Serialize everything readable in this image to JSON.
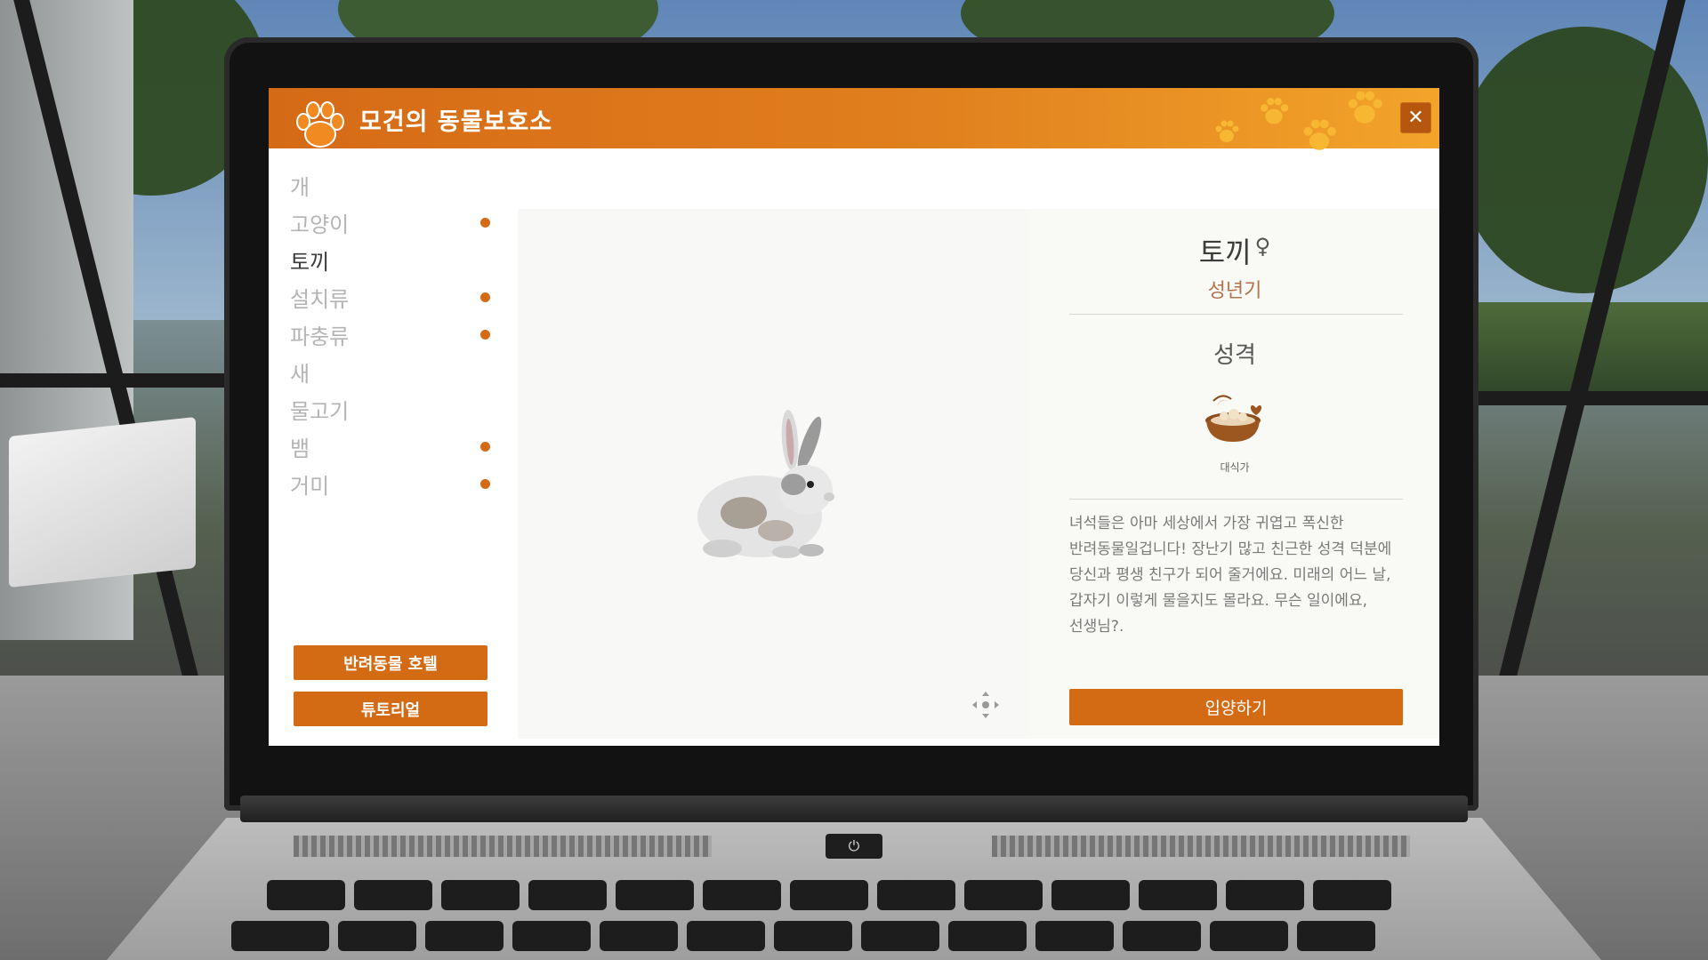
{
  "app": {
    "title": "모건의 동물보호소",
    "close_label": "✕"
  },
  "sidebar": {
    "categories": [
      {
        "label": "개",
        "active": false,
        "has_dot": false
      },
      {
        "label": "고양이",
        "active": false,
        "has_dot": true
      },
      {
        "label": "토끼",
        "active": true,
        "has_dot": false
      },
      {
        "label": "설치류",
        "active": false,
        "has_dot": true
      },
      {
        "label": "파충류",
        "active": false,
        "has_dot": true
      },
      {
        "label": "새",
        "active": false,
        "has_dot": false
      },
      {
        "label": "물고기",
        "active": false,
        "has_dot": false
      },
      {
        "label": "뱀",
        "active": false,
        "has_dot": true
      },
      {
        "label": "거미",
        "active": false,
        "has_dot": true
      }
    ],
    "buttons": {
      "hotel": "반려동물 호텔",
      "tutorial": "튜토리얼"
    }
  },
  "detail": {
    "name": "토끼",
    "gender_symbol": "♀",
    "age": "성년기",
    "section_title": "성격",
    "trait": {
      "icon": "food-bowl-icon",
      "label": "대식가"
    },
    "description": "녀석들은 아마 세상에서 가장 귀엽고 폭신한 반려동물일겁니다! 장난기 많고 친근한 성격 덕분에 당신과 평생 친구가 되어 줄거에요. 미래의 어느 날, 갑자기 이렇게 물을지도 몰라요. 무슨 일이에요, 선생님?.",
    "adopt_label": "입양하기"
  },
  "colors": {
    "accent": "#d36b14",
    "accent_dark": "#b5570f",
    "dot": "#d56a16",
    "age_text": "#b2734a"
  }
}
